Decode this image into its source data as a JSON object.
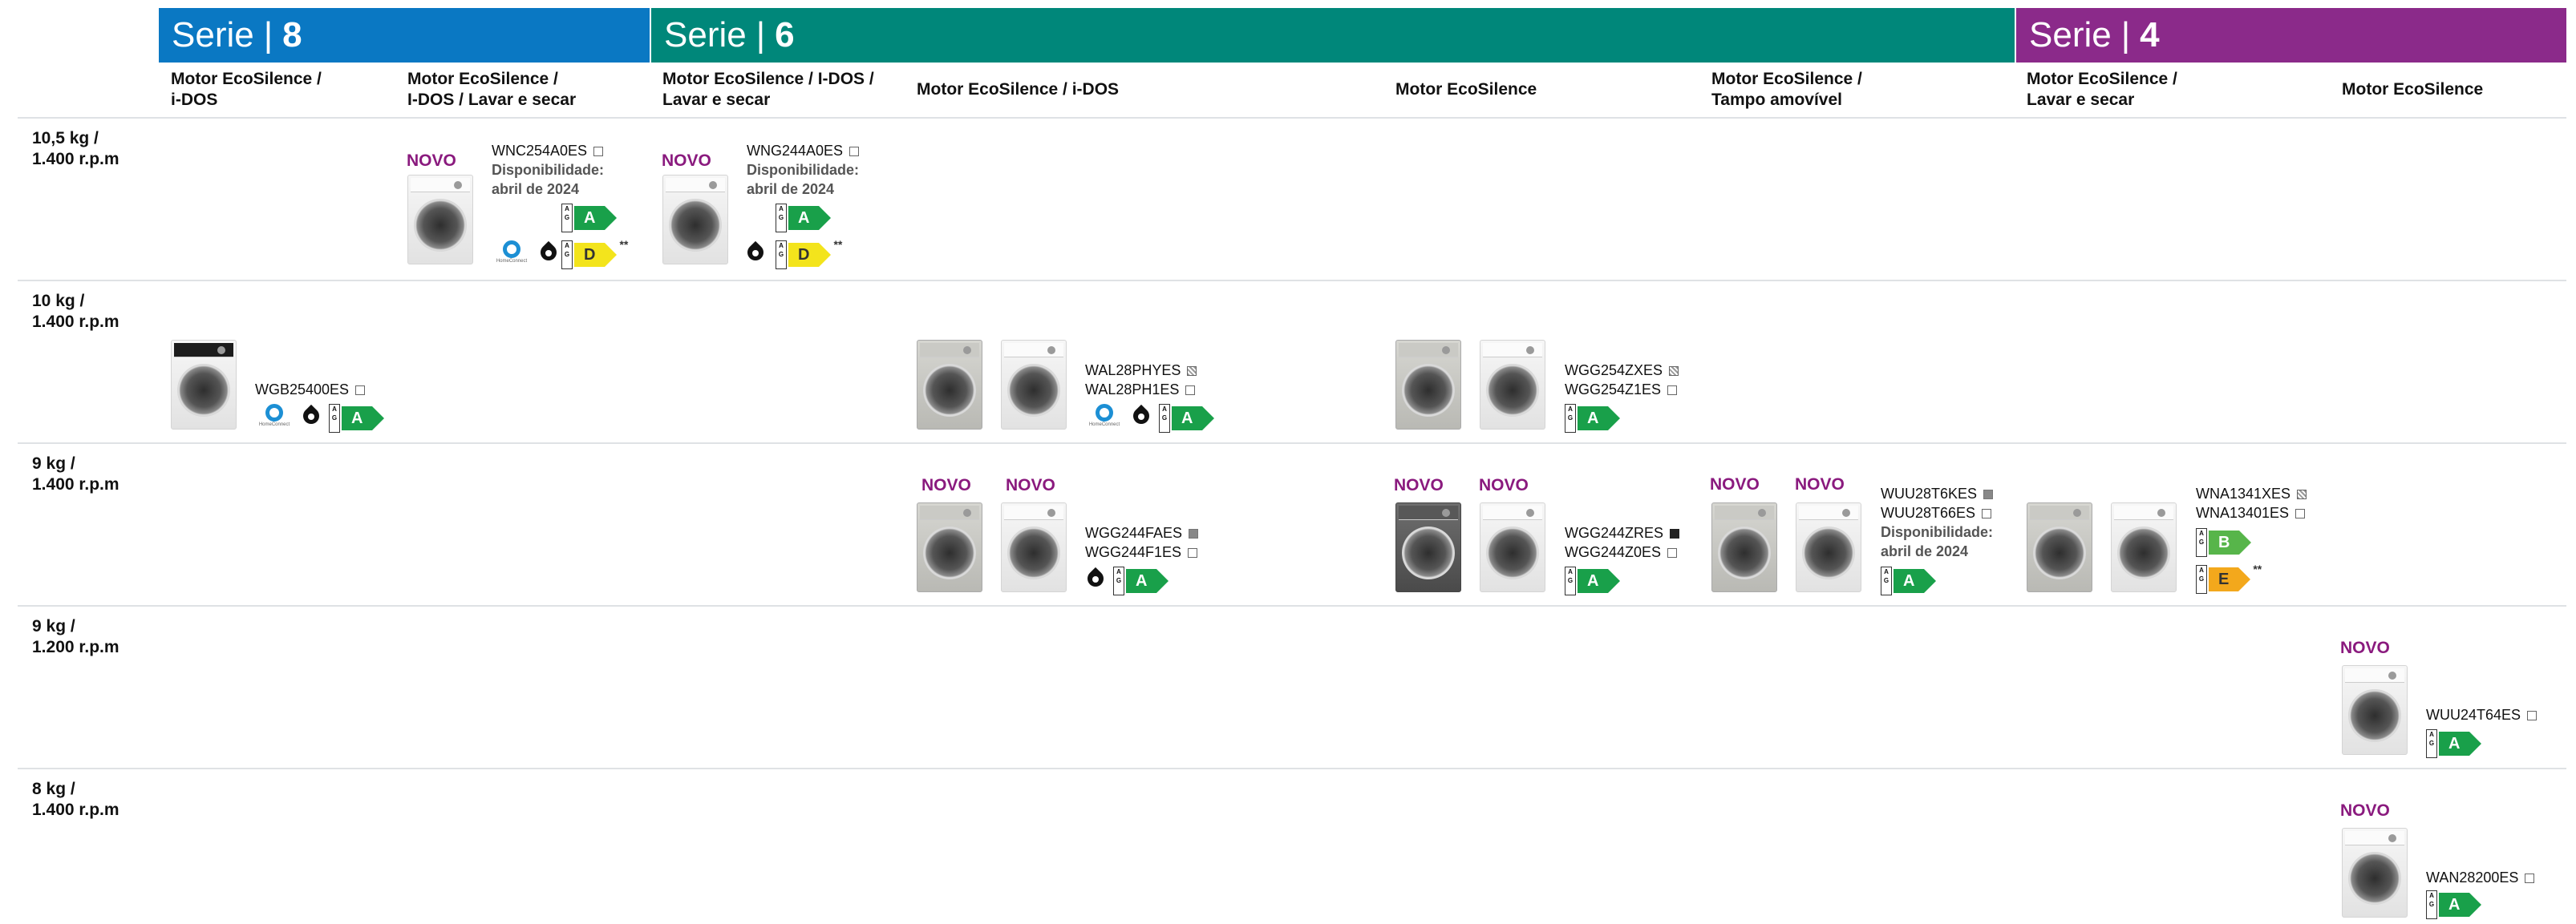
{
  "series_bars": [
    {
      "word": "Serie",
      "sep": "|",
      "number": "8",
      "color": "#0a78c3"
    },
    {
      "word": "Serie",
      "sep": "|",
      "number": "6",
      "color": "#00877a"
    },
    {
      "word": "Serie",
      "sep": "|",
      "number": "4",
      "color": "#8b2a8a"
    }
  ],
  "columns": [
    {
      "line1": "Motor EcoSilence /",
      "line2": "i-DOS"
    },
    {
      "line1": "Motor EcoSilence /",
      "line2": "I-DOS / Lavar e secar"
    },
    {
      "line1": "Motor EcoSilence / I-DOS /",
      "line2": "Lavar e secar"
    },
    {
      "line1": "Motor EcoSilence / i-DOS",
      "line2": ""
    },
    {
      "line1": "Motor EcoSilence",
      "line2": ""
    },
    {
      "line1": "Motor EcoSilence /",
      "line2": "Tampo amovível"
    },
    {
      "line1": "Motor EcoSilence /",
      "line2": "Lavar e secar"
    },
    {
      "line1": "Motor EcoSilence",
      "line2": ""
    }
  ],
  "rows": [
    {
      "line1": "10,5 kg /",
      "line2": "1.400 r.p.m"
    },
    {
      "line1": "10 kg /",
      "line2": "1.400 r.p.m"
    },
    {
      "line1": "9 kg /",
      "line2": "1.400 r.p.m"
    },
    {
      "line1": "9 kg /",
      "line2": "1.200 r.p.m"
    },
    {
      "line1": "8 kg /",
      "line2": "1.400 r.p.m"
    }
  ],
  "novo_label": "NOVO",
  "availability": {
    "line1": "Disponibilidade:",
    "line2": "abril de 2024"
  },
  "home_connect_text": "HomeConnect",
  "energy_scale_text": "A G",
  "footnote_single": "*",
  "footnote_double": "**",
  "models": {
    "wnc254a0es": "WNC254A0ES",
    "wng244a0es": "WNG244A0ES",
    "wgb25400es": "WGB25400ES",
    "wal28phyes": "WAL28PHYES",
    "wal28ph1es": "WAL28PH1ES",
    "wgg254zxes": "WGG254ZXES",
    "wgg254z1es": "WGG254Z1ES",
    "wgg244faes": "WGG244FAES",
    "wgg244f1es": "WGG244F1ES",
    "wgg244zres": "WGG244ZRES",
    "wgg244z0es": "WGG244Z0ES",
    "wuu28t6kes": "WUU28T6KES",
    "wuu28t66es": "WUU28T66ES",
    "wna1341xes": "WNA1341XES",
    "wna13401es": "WNA13401ES",
    "wuu24t64es": "WUU24T64ES",
    "wan28200es": "WAN28200ES"
  },
  "energy_classes": {
    "a": "A",
    "b": "B",
    "d": "D",
    "e": "E"
  },
  "colors": {
    "novo": "#8a1a7e",
    "energy_a": "#19a04a",
    "energy_b": "#57b54a",
    "energy_d": "#f3e41c",
    "energy_e": "#f3a81c"
  }
}
